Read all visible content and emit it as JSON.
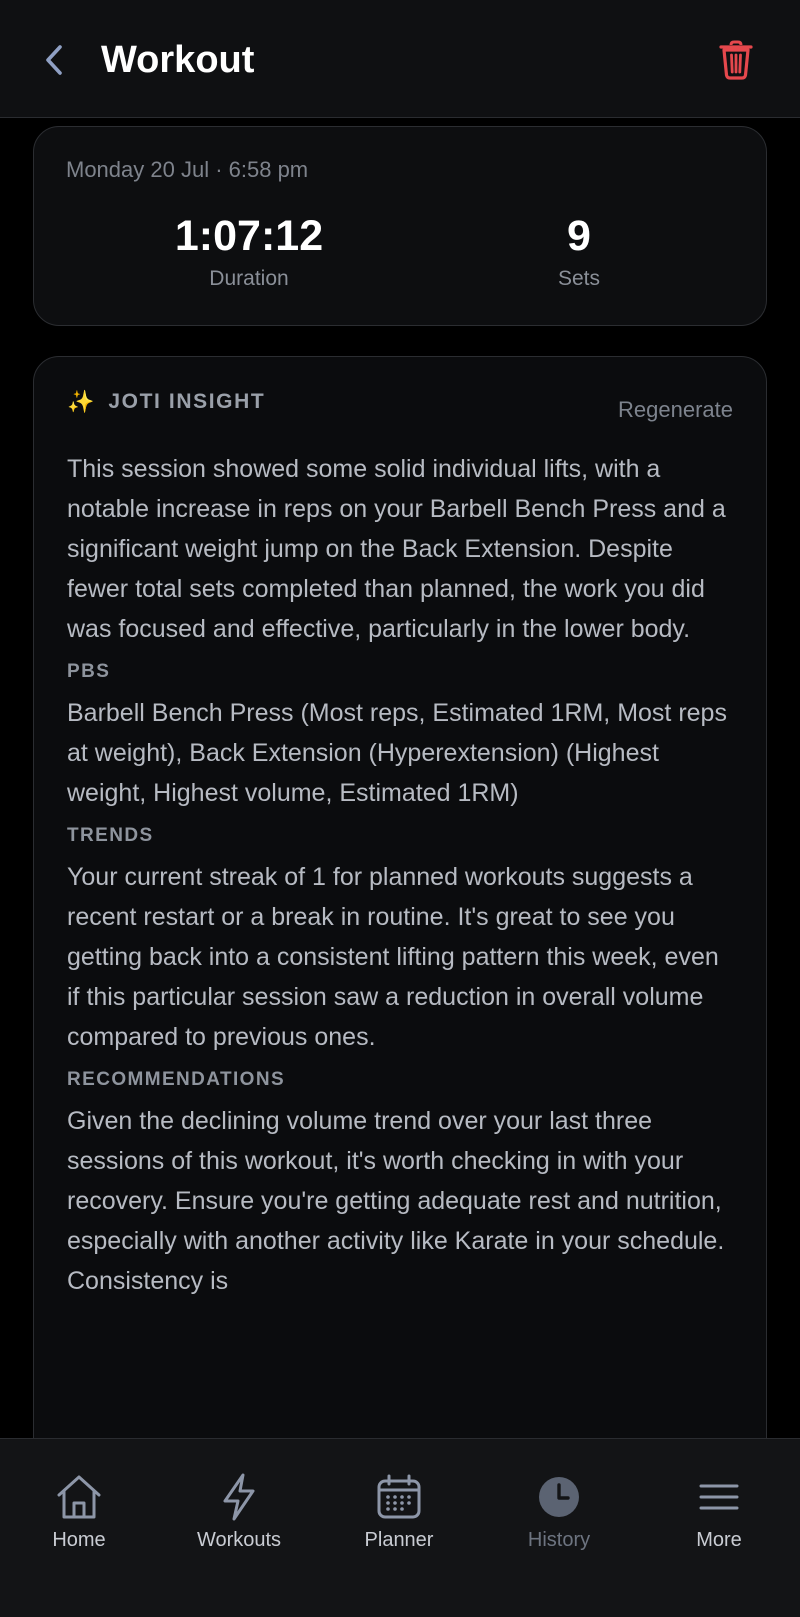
{
  "header": {
    "title": "Workout",
    "back_icon": "chevron-left-icon",
    "delete_icon": "trash-icon",
    "delete_color": "#e5484d"
  },
  "summary": {
    "date": "Monday 20 Jul · 6:58 pm",
    "duration_value": "1:07:12",
    "duration_label": "Duration",
    "sets_value": "9",
    "sets_label": "Sets"
  },
  "insight": {
    "icon": "✨",
    "title": "JOTI INSIGHT",
    "regenerate_label": "Regenerate",
    "summary_text": "This session showed some solid individual lifts, with a notable increase in reps on your Barbell Bench Press and a significant weight jump on the Back Extension. Despite fewer total sets completed than planned, the work you did was focused and effective, particularly in the lower body.",
    "pbs_label": "PBS",
    "pbs_text": "Barbell Bench Press (Most reps, Estimated 1RM, Most reps at weight), Back Extension (Hyperextension) (Highest weight, Highest volume, Estimated 1RM)",
    "trends_label": "TRENDS",
    "trends_text": "Your current streak of 1 for planned workouts suggests a recent restart or a break in routine. It's great to see you getting back into a consistent lifting pattern this week, even if this particular session saw a reduction in overall volume compared to previous ones.",
    "recommendations_label": "RECOMMENDATIONS",
    "recommendations_text": "Given the declining volume trend over your last three sessions of this workout, it's worth checking in with your recovery. Ensure you're getting adequate rest and nutrition, especially with another activity like Karate in your schedule. Consistency is"
  },
  "tabs": [
    {
      "label": "Home",
      "icon": "home-icon"
    },
    {
      "label": "Workouts",
      "icon": "lightning-icon"
    },
    {
      "label": "Planner",
      "icon": "calendar-icon"
    },
    {
      "label": "History",
      "icon": "clock-icon"
    },
    {
      "label": "More",
      "icon": "menu-icon"
    }
  ]
}
